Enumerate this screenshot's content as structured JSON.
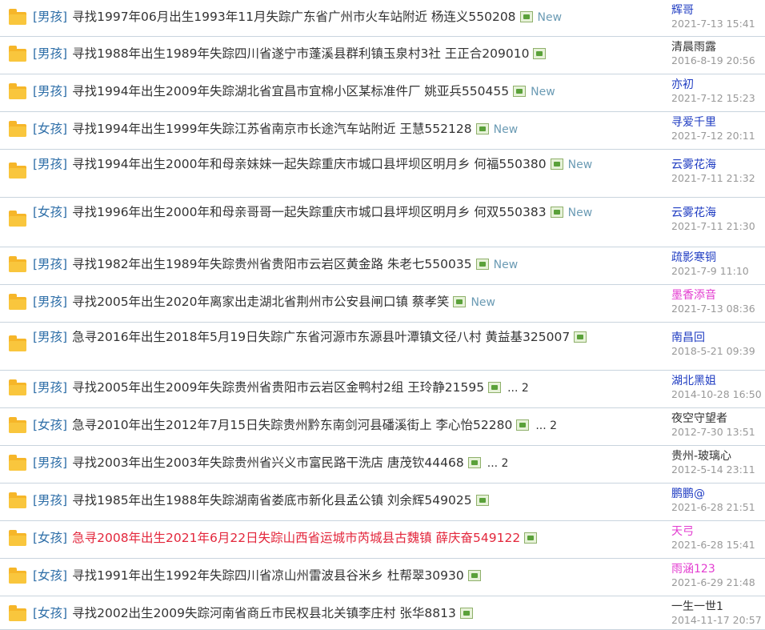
{
  "threads": [
    {
      "tag": "[男孩]",
      "title": "寻找1997年06月出生1993年11月失踪广东省广州市火车站附近 杨连义550208",
      "has_image": true,
      "new": "New",
      "pages": "",
      "author": "辉哥",
      "author_color": "#1f3cc2",
      "date": "2021-7-13 15:41",
      "title_color": ""
    },
    {
      "tag": "[男孩]",
      "title": "寻找1988年出生1989年失踪四川省遂宁市蓬溪县群利镇玉泉村3社 王正合209010",
      "has_image": true,
      "new": "",
      "pages": "",
      "author": "清晨雨露",
      "author_color": "#333333",
      "date": "2016-8-19 20:56",
      "title_color": ""
    },
    {
      "tag": "[男孩]",
      "title": "寻找1994年出生2009年失踪湖北省宜昌市宜棉小区某标准件厂 姚亚兵550455",
      "has_image": true,
      "new": "New",
      "pages": "",
      "author": "亦初",
      "author_color": "#1f3cc2",
      "date": "2021-7-12 15:23",
      "title_color": ""
    },
    {
      "tag": "[女孩]",
      "title": "寻找1994年出生1999年失踪江苏省南京市长途汽车站附近 王慧552128",
      "has_image": true,
      "new": "New",
      "pages": "",
      "author": "寻爱千里",
      "author_color": "#1f3cc2",
      "date": "2021-7-12 20:11",
      "title_color": ""
    },
    {
      "tag": "[男孩]",
      "title": "寻找1994年出生2000年和母亲妹妹一起失踪重庆市城口县坪坝区明月乡 何福550380",
      "has_image": true,
      "new": "New",
      "pages": "",
      "author": "云雾花海",
      "author_color": "#1f3cc2",
      "date": "2021-7-11 21:32",
      "title_color": ""
    },
    {
      "tag": "[女孩]",
      "title": "寻找1996年出生2000年和母亲哥哥一起失踪重庆市城口县坪坝区明月乡 何双550383",
      "has_image": true,
      "new": "New",
      "pages": "",
      "author": "云雾花海",
      "author_color": "#1f3cc2",
      "date": "2021-7-11 21:30",
      "title_color": ""
    },
    {
      "tag": "[男孩]",
      "title": "寻找1982年出生1989年失踪贵州省贵阳市云岩区黄金路 朱老七550035",
      "has_image": true,
      "new": "New",
      "pages": "",
      "author": "疏影寒铜",
      "author_color": "#1f3cc2",
      "date": "2021-7-9 11:10",
      "title_color": ""
    },
    {
      "tag": "[男孩]",
      "title": "寻找2005年出生2020年离家出走湖北省荆州市公安县闸口镇 蔡孝笑",
      "has_image": true,
      "new": "New",
      "pages": "",
      "author": "墨香添音",
      "author_color": "#e33cd0",
      "date": "2021-7-13 08:36",
      "title_color": ""
    },
    {
      "tag": "[男孩]",
      "title": "急寻2016年出生2018年5月19日失踪广东省河源市东源县叶潭镇文径八村 黄益基325007",
      "has_image": true,
      "new": "",
      "pages": "",
      "author": "南昌回",
      "author_color": "#1f3cc2",
      "date": "2018-5-21 09:39",
      "title_color": ""
    },
    {
      "tag": "[男孩]",
      "title": "寻找2005年出生2009年失踪贵州省贵阳市云岩区金鸭村2组 王玲静21595",
      "has_image": true,
      "new": "",
      "pages": "... 2",
      "author": "湖北黑姐",
      "author_color": "#1f3cc2",
      "date": "2014-10-28 16:50",
      "title_color": ""
    },
    {
      "tag": "[女孩]",
      "title": "急寻2010年出生2012年7月15日失踪贵州黔东南剑河县磻溪街上 李心怡52280",
      "has_image": true,
      "new": "",
      "pages": "... 2",
      "author": "夜空守望者",
      "author_color": "#333333",
      "date": "2012-7-30 13:51",
      "title_color": ""
    },
    {
      "tag": "[男孩]",
      "title": "寻找2003年出生2003年失踪贵州省兴义市富民路干洗店 唐茂钦44468",
      "has_image": true,
      "new": "",
      "pages": "... 2",
      "author": "贵州-玻璃心",
      "author_color": "#333333",
      "date": "2012-5-14 23:11",
      "title_color": ""
    },
    {
      "tag": "[男孩]",
      "title": "寻找1985年出生1988年失踪湖南省娄底市新化县孟公镇 刘余辉549025",
      "has_image": true,
      "new": "",
      "pages": "",
      "author": "鹏鹏@",
      "author_color": "#1f3cc2",
      "date": "2021-6-28 21:51",
      "title_color": ""
    },
    {
      "tag": "[女孩]",
      "title": "急寻2008年出生2021年6月22日失踪山西省运城市芮城县古魏镇 薛庆奋549122",
      "has_image": true,
      "new": "",
      "pages": "",
      "author": "天弓",
      "author_color": "#e33cd0",
      "date": "2021-6-28 15:41",
      "title_color": "#e3273c"
    },
    {
      "tag": "[女孩]",
      "title": "寻找1991年出生1992年失踪四川省凉山州雷波县谷米乡 杜帮翠30930",
      "has_image": true,
      "new": "",
      "pages": "",
      "author": "雨涵123",
      "author_color": "#e33cd0",
      "date": "2021-6-29 21:48",
      "title_color": ""
    },
    {
      "tag": "[女孩]",
      "title": "寻找2002出生2009失踪河南省商丘市民权县北关镇李庄村 张华8813",
      "has_image": true,
      "new": "",
      "pages": "",
      "author": "一生一世1",
      "author_color": "#333333",
      "date": "2014-11-17 20:57",
      "title_color": ""
    }
  ]
}
